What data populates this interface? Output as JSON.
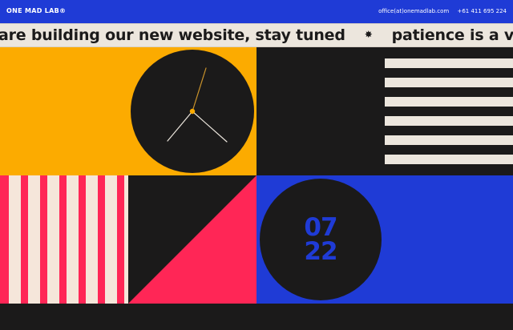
{
  "header": {
    "logo": "ONE MAD LAB®",
    "email": "office(at)onemadlab.com",
    "phone": "+61 411 695 224"
  },
  "ticker": {
    "message_1": "are building our new website, stay tuned",
    "separator": "✸",
    "message_2": "patience is a virtue"
  },
  "date_badge": {
    "month": "07",
    "year": "22"
  },
  "colors": {
    "blue": "#1f3bd6",
    "amber": "#fcab00",
    "black": "#1b1a1a",
    "cream": "#ece6dd",
    "pink": "#ff2656"
  },
  "icons": [
    "clock-icon"
  ]
}
